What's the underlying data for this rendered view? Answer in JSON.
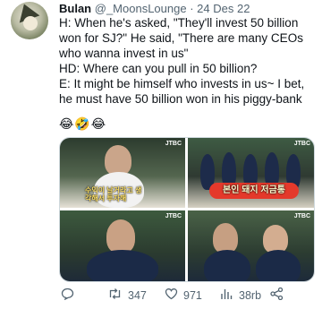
{
  "tweet": {
    "author_name": "Bulan",
    "handle": "@_MoonsLounge",
    "separator": "·",
    "date": "24 Des 22",
    "lines": [
      "H: When he's asked, \"They'll invest 50 billion won for SJ?\" He said, \"There are many CEOs who wanna invest in us\"",
      "HD: Where can you pull in 50 billion?",
      "E: It might be himself who invests in us~ I bet, he must have 50 billion won in his piggy-bank"
    ],
    "emojis": "😂🤣😂"
  },
  "media": {
    "logo": "JTBC",
    "caption_1": "수익이 날거라고 생각해서 투자해",
    "caption_2": "본인 돼지 저금통"
  },
  "actions": {
    "reply_icon": "reply-icon",
    "retweet_count": "347",
    "retweet_icon": "retweet-icon",
    "like_count": "971",
    "like_icon": "heart-icon",
    "views_count": "38rb",
    "views_icon": "views-icon",
    "share_icon": "share-icon"
  }
}
